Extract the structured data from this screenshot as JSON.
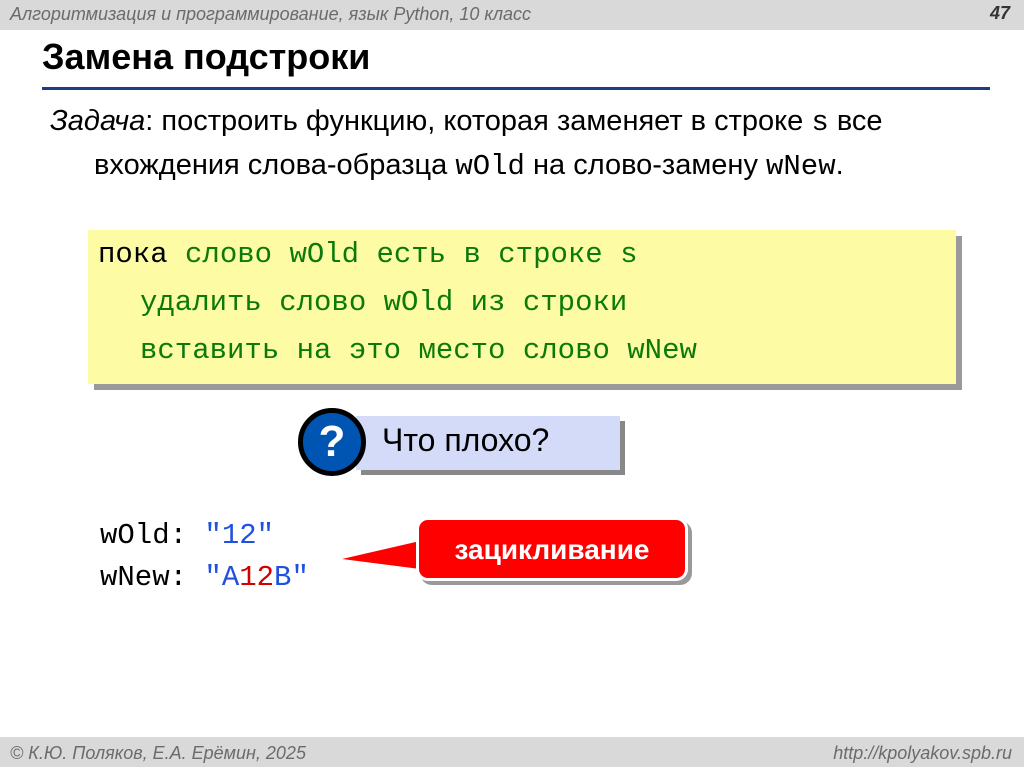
{
  "header": {
    "course": "Алгоритмизация и программирование, язык Python, 10 класс",
    "slide_number": "47"
  },
  "title": "Замена подстроки",
  "task": {
    "label": "Задача",
    "t1": ": построить функцию, которая заменяет в строке ",
    "s": "s",
    "t2": " все вхождения слова-образца ",
    "wOld": "wOld",
    "t3": " на слово-замену ",
    "wNew": "wNew",
    "t4": "."
  },
  "algo": {
    "l1_kw": "пока",
    "l1_rest": " слово wOld есть в строке s",
    "l2": "удалить слово wOld из строки",
    "l3": "вставить на это место слово wNew"
  },
  "question": {
    "icon": "?",
    "text": "Что плохо?"
  },
  "example": {
    "wold_label": "wOld: ",
    "wold_value": "\"12\"",
    "wnew_label": "wNew: ",
    "wnew_q1": "\"A",
    "wnew_mid": "12",
    "wnew_q2": "B\""
  },
  "callout": "зацикливание",
  "footer": {
    "authors": "© К.Ю. Поляков, Е.А. Ерёмин, 2025",
    "url": "http://kpolyakov.spb.ru"
  },
  "colors": {
    "accent_blue": "#0055b3",
    "code_green": "#0b7a0b",
    "box_yellow": "#fdfba4",
    "callout_red": "#ff0000"
  }
}
